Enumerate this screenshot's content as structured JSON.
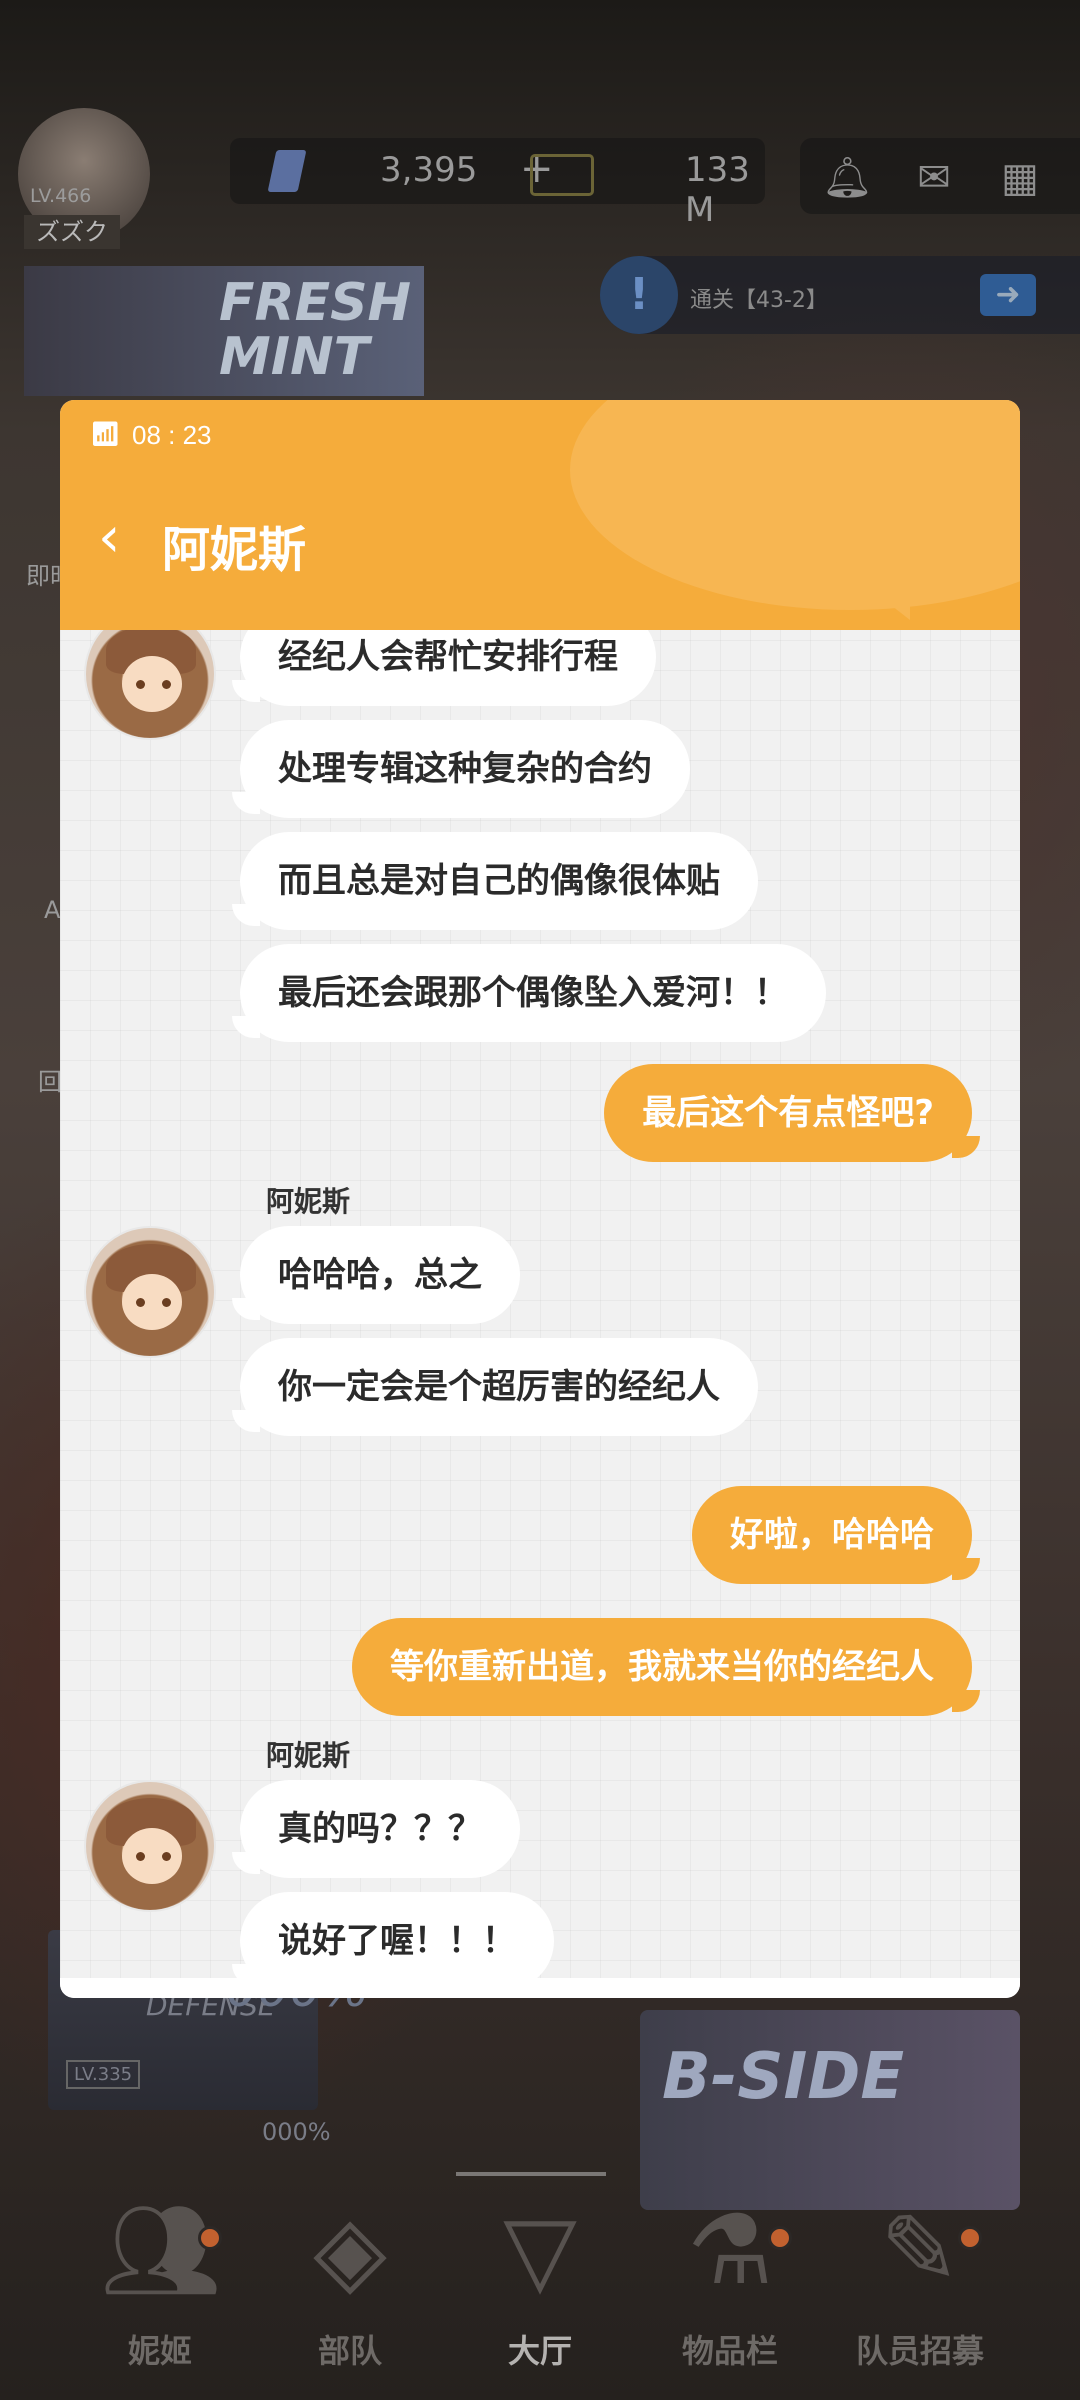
{
  "background": {
    "player_level": "LV.466",
    "player_name": "ズズク",
    "gems": "3,395",
    "gem_plus": "+",
    "credits": "133 M",
    "pass_title": "FRESH MINT",
    "quest_text": "通关【43-2】",
    "left_label_1": "即时",
    "left_label_2": "A",
    "left_label_3": "回",
    "outpost_title": "OUTPOST DEFENSE",
    "outpost_percent": "000%",
    "outpost_level": "LV.335",
    "outpost_percent_small": "000%",
    "bside_title": "B-SIDE"
  },
  "bottom_nav": [
    {
      "label": "妮姬",
      "icon": "nikke-icon",
      "badge": true
    },
    {
      "label": "部队",
      "icon": "squad-icon",
      "badge": false
    },
    {
      "label": "大厅",
      "icon": "lobby-icon",
      "badge": false,
      "active": true
    },
    {
      "label": "物品栏",
      "icon": "inventory-icon",
      "badge": true
    },
    {
      "label": "队员招募",
      "icon": "recruit-icon",
      "badge": true
    }
  ],
  "chat": {
    "status_time": "08 : 23",
    "contact_name": "阿妮斯",
    "messages": [
      {
        "from": "them",
        "text": "经纪人会帮忙安排行程"
      },
      {
        "from": "them",
        "text": "处理专辑这种复杂的合约"
      },
      {
        "from": "them",
        "text": "而且总是对自己的偶像很体贴"
      },
      {
        "from": "them",
        "text": "最后还会跟那个偶像坠入爱河！！"
      },
      {
        "from": "me",
        "text": "最后这个有点怪吧?"
      },
      {
        "from": "them",
        "sender": "阿妮斯",
        "text": "哈哈哈，总之"
      },
      {
        "from": "them",
        "text": "你一定会是个超厉害的经纪人"
      },
      {
        "from": "me",
        "text": "好啦，哈哈哈"
      },
      {
        "from": "me",
        "text": "等你重新出道，我就来当你的经纪人"
      },
      {
        "from": "them",
        "sender": "阿妮斯",
        "text": "真的吗？？？"
      },
      {
        "from": "them",
        "text": "说好了喔！！！"
      }
    ]
  }
}
